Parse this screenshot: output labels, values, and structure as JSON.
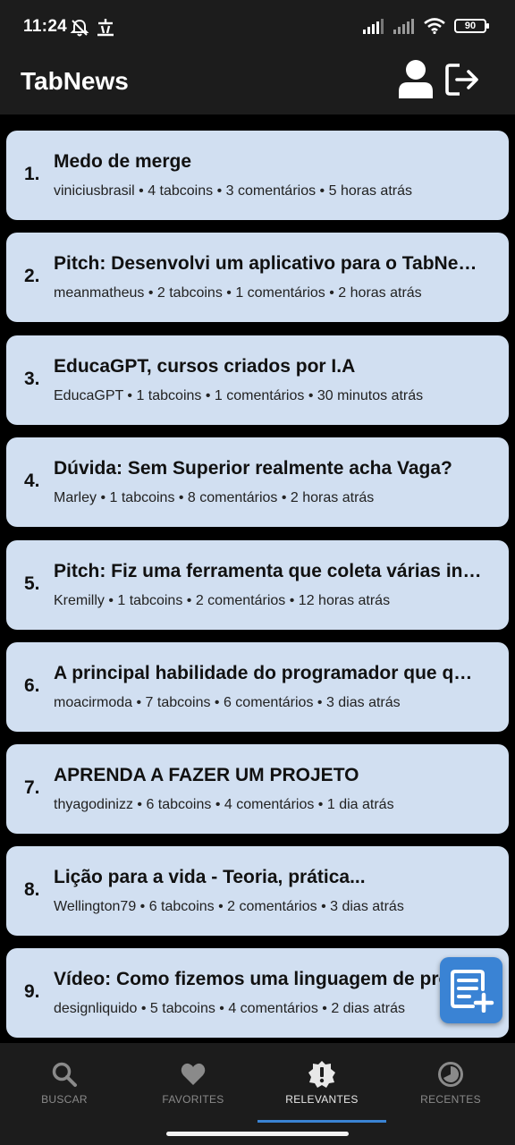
{
  "status_bar": {
    "time": "11:24",
    "battery": "90",
    "icons": [
      "no-disturb-icon",
      "ime-icon",
      "signal-icon",
      "signal-icon",
      "wifi-icon",
      "battery-icon"
    ]
  },
  "app_bar": {
    "title": "TabNews",
    "profile_icon": "person-icon",
    "logout_icon": "logout-icon"
  },
  "posts": [
    {
      "rank": "1.",
      "title": "Medo de merge",
      "meta": "viniciusbrasil • 4 tabcoins • 3 comentários • 5 horas atrás"
    },
    {
      "rank": "2.",
      "title": "Pitch: Desenvolvi um aplicativo para o TabNews",
      "meta": "meanmatheus • 2 tabcoins • 1 comentários • 2 horas atrás"
    },
    {
      "rank": "3.",
      "title": "EducaGPT, cursos criados por I.A",
      "meta": "EducaGPT • 1 tabcoins • 1 comentários • 30 minutos atrás"
    },
    {
      "rank": "4.",
      "title": "Dúvida: Sem Superior realmente acha Vaga?",
      "meta": "Marley • 1 tabcoins • 8 comentários • 2 horas atrás"
    },
    {
      "rank": "5.",
      "title": "Pitch: Fiz uma ferramenta que coleta várias infor...",
      "meta": "Kremilly • 1 tabcoins • 2 comentários • 12 horas atrás"
    },
    {
      "rank": "6.",
      "title": "A principal habilidade do programador que quer...",
      "meta": "moacirmoda • 7 tabcoins • 6 comentários • 3 dias atrás"
    },
    {
      "rank": "7.",
      "title": "APRENDA A FAZER UM PROJETO",
      "meta": "thyagodinizz • 6 tabcoins • 4 comentários • 1 dia atrás"
    },
    {
      "rank": "8.",
      "title": "Lição para a vida - Teoria, prática...",
      "meta": "Wellington79 • 6 tabcoins • 2 comentários • 3 dias atrás"
    },
    {
      "rank": "9.",
      "title": "Vídeo: Como fizemos uma linguagem de programação",
      "meta": "designliquido • 5 tabcoins • 4 comentários • 2 dias atrás"
    }
  ],
  "fab": {
    "icon": "new-post-icon"
  },
  "bottom_nav": {
    "items": [
      {
        "label": "BUSCAR",
        "icon": "search-icon"
      },
      {
        "label": "FAVORITES",
        "icon": "heart-icon"
      },
      {
        "label": "RELEVANTES",
        "icon": "alert-badge-icon"
      },
      {
        "label": "RECENTES",
        "icon": "clock-icon"
      }
    ],
    "active": "RELEVANTES"
  },
  "colors": {
    "card_bg": "#d1dff1",
    "bar_bg": "#1c1c1c",
    "accent": "#3a83d4"
  }
}
